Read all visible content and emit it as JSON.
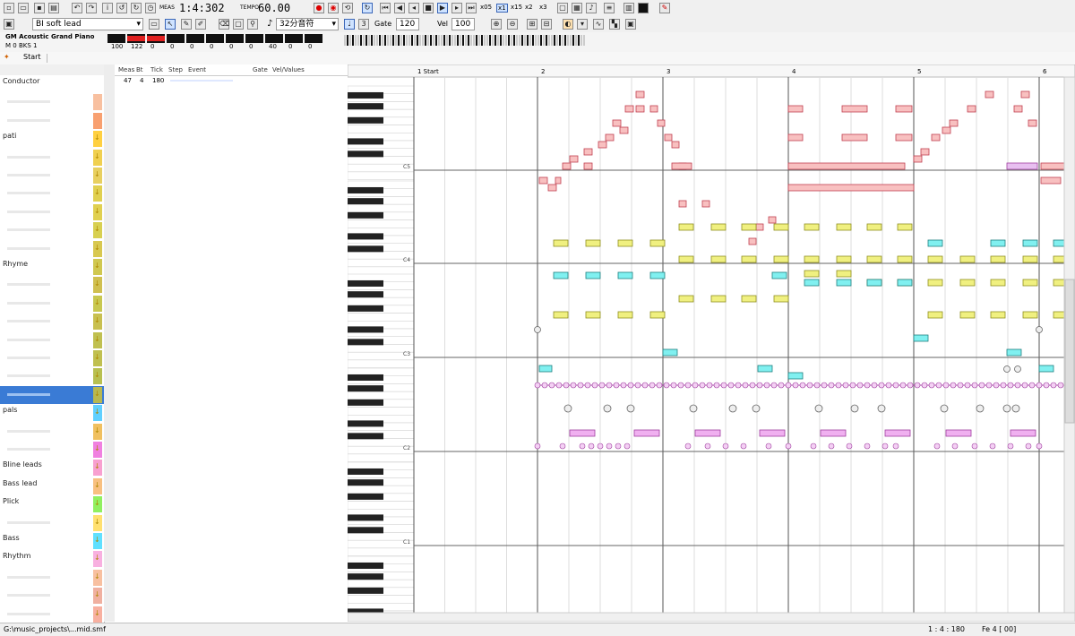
{
  "toolbar": {
    "track_name": "BI soft lead",
    "meas_label": "MEAS",
    "position": "1:4:302",
    "tempo_label": "TEMPO",
    "tempo": "60.00",
    "instrument": "GM Acoustic Grand Piano",
    "grid": "32分音符",
    "gate_label": "Gate",
    "gate": "120",
    "vel_label": "Vel",
    "vel": "100",
    "zoom": [
      "x05",
      "x1",
      "x15",
      "x2",
      "x3"
    ],
    "meter_values": [
      "100",
      "122",
      "0",
      "0",
      "0",
      "0",
      "0",
      "0",
      "40",
      "0",
      "0"
    ],
    "row3_small": "M  0  BKS  1"
  },
  "breadcrumb": "Start",
  "tracks": [
    {
      "name": "Conductor",
      "sub": "",
      "color": "#ffffff"
    },
    {
      "name": "",
      "sub": "",
      "color": "#f8c0a0"
    },
    {
      "name": "",
      "sub": "",
      "color": "#f8a070"
    },
    {
      "name": "pati",
      "sub": "",
      "color": "#ffd040"
    },
    {
      "name": "",
      "sub": "",
      "color": "#f0d050"
    },
    {
      "name": "",
      "sub": "",
      "color": "#e8d060"
    },
    {
      "name": "",
      "sub": "",
      "color": "#e0d050"
    },
    {
      "name": "",
      "sub": "",
      "color": "#e0d050"
    },
    {
      "name": "",
      "sub": "",
      "color": "#d8d050"
    },
    {
      "name": "",
      "sub": "",
      "color": "#d8c850"
    },
    {
      "name": "Rhyme",
      "sub": "",
      "color": "#d0c850"
    },
    {
      "name": "",
      "sub": "",
      "color": "#d0c050"
    },
    {
      "name": "",
      "sub": "",
      "color": "#c8c850"
    },
    {
      "name": "",
      "sub": "",
      "color": "#c8c050"
    },
    {
      "name": "",
      "sub": "",
      "color": "#c0c050"
    },
    {
      "name": "",
      "sub": "",
      "color": "#c0c050"
    },
    {
      "name": "",
      "sub": "",
      "color": "#b8c050"
    },
    {
      "name": "",
      "sub": "",
      "color": "#b8b850"
    },
    {
      "name": "pals",
      "sub": "",
      "color": "#60d0ff"
    },
    {
      "name": "",
      "sub": "",
      "color": "#f0c060"
    },
    {
      "name": "",
      "sub": "",
      "color": "#f080e0"
    },
    {
      "name": "Bline leads",
      "sub": "",
      "color": "#f8a0d0"
    },
    {
      "name": "Bass lead",
      "sub": "",
      "color": "#f8c080"
    },
    {
      "name": "Plick",
      "sub": "",
      "color": "#90f060"
    },
    {
      "name": "",
      "sub": "",
      "color": "#ffe070"
    },
    {
      "name": "Bass",
      "sub": "",
      "color": "#60e0ff"
    },
    {
      "name": "Rhythm",
      "sub": "",
      "color": "#f8b0e0"
    },
    {
      "name": "",
      "sub": "",
      "color": "#f8c0a0"
    },
    {
      "name": "",
      "sub": "",
      "color": "#f0b0a0"
    },
    {
      "name": "",
      "sub": "",
      "color": "#f8b0a0"
    }
  ],
  "event_list": {
    "headers": [
      "Meas",
      "Bt",
      "Tick",
      "Step",
      "Event",
      "Gate",
      "Vel/Values"
    ],
    "row": [
      "47",
      "4",
      "180"
    ]
  },
  "roll": {
    "measure_labels": [
      "1 Start",
      "2",
      "3",
      "4",
      "5",
      "6"
    ],
    "octave_labels": [
      "C5",
      "C4",
      "C3",
      "C2",
      "C1"
    ]
  },
  "status": {
    "left": "G:\\music_projects\\...mid.smf",
    "position": "1 : 4 : 180",
    "right": "Fe 4 [ 00]"
  }
}
